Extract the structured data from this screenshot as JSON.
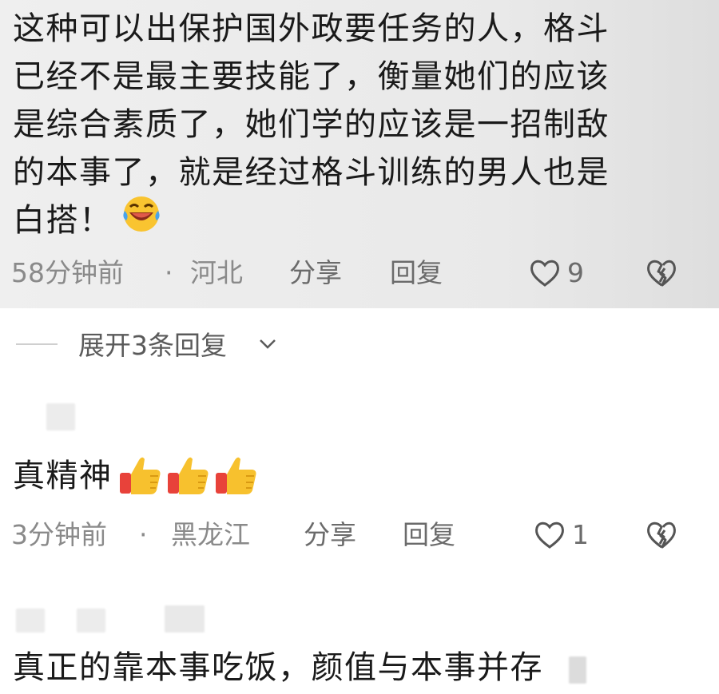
{
  "comment1": {
    "lines": [
      "这种可以出保护国外政要任务的人，格斗",
      "已经不是最主要技能了，衡量她们的应该",
      "是综合素质了，她们学的应该是一招制敌",
      "的本事了，就是经过格斗训练的男人也是",
      "白搭！"
    ],
    "emoji": "laughing-crying-emoji",
    "meta": {
      "time": "58分钟前",
      "dot": "·",
      "location": "河北",
      "share": "分享",
      "reply": "回复",
      "likes": "9"
    }
  },
  "expand": {
    "label": "展开3条回复"
  },
  "comment2": {
    "text": "真精神",
    "emoji": "thumbs-up-emoji",
    "emoji_count": 3,
    "meta": {
      "time": "3分钟前",
      "dot": "·",
      "location": "黑龙江",
      "share": "分享",
      "reply": "回复",
      "likes": "1"
    }
  },
  "comment3": {
    "text": "真正的靠本事吃饭，颜值与本事并存"
  },
  "colors": {
    "highlight_bg": "#ebebeb",
    "meta_text": "#8a8a8a",
    "thumb_yellow": "#f7c12e",
    "thumb_red": "#e8423a"
  }
}
